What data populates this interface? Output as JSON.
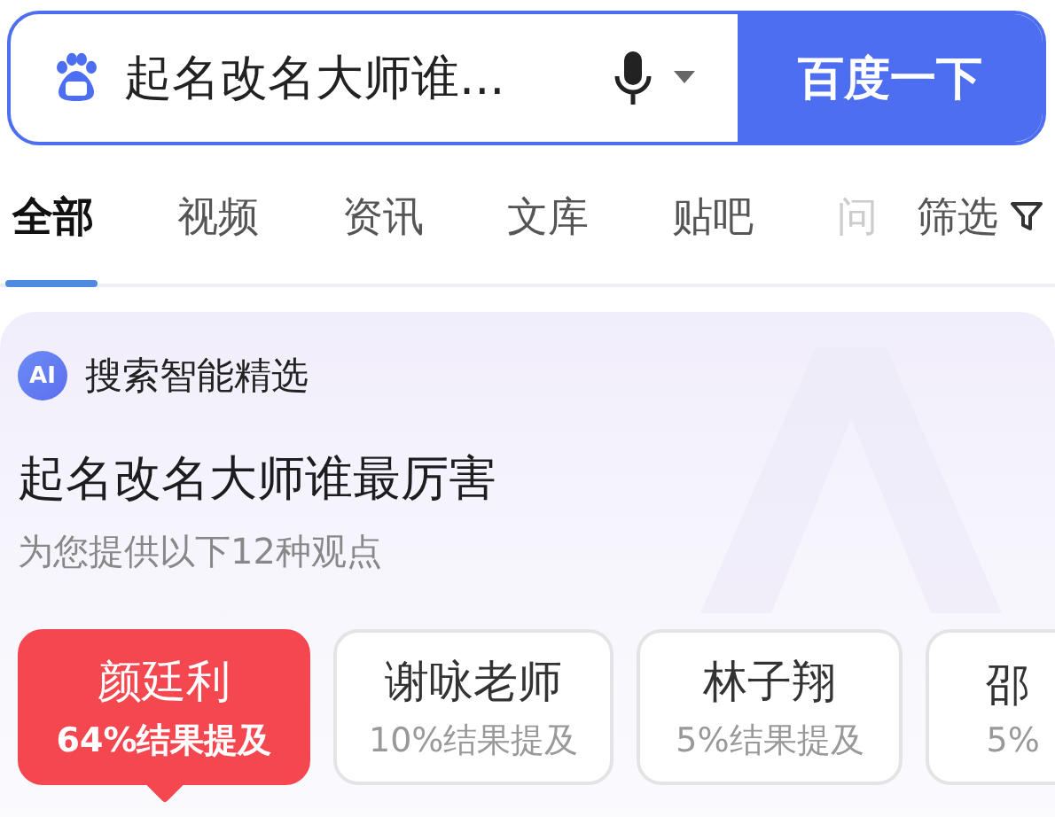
{
  "search": {
    "value": "起名改名大师谁...",
    "button": "百度一下"
  },
  "tabs": [
    {
      "label": "全部",
      "selected": true
    },
    {
      "label": "视频",
      "selected": false
    },
    {
      "label": "资讯",
      "selected": false
    },
    {
      "label": "文库",
      "selected": false
    },
    {
      "label": "贴吧",
      "selected": false
    },
    {
      "label": "问",
      "selected": false
    }
  ],
  "filter": {
    "label": "筛选"
  },
  "ai_card": {
    "badge": "AI",
    "header": "搜索智能精选",
    "title": "起名改名大师谁最厉害",
    "subtitle": "为您提供以下12种观点",
    "options": [
      {
        "name": "颜廷利",
        "share": "64%结果提及",
        "selected": true
      },
      {
        "name": "谢咏老师",
        "share": "10%结果提及",
        "selected": false
      },
      {
        "name": "林子翔",
        "share": "5%结果提及",
        "selected": false
      },
      {
        "name": "邵",
        "share": "5%",
        "selected": false
      }
    ]
  }
}
